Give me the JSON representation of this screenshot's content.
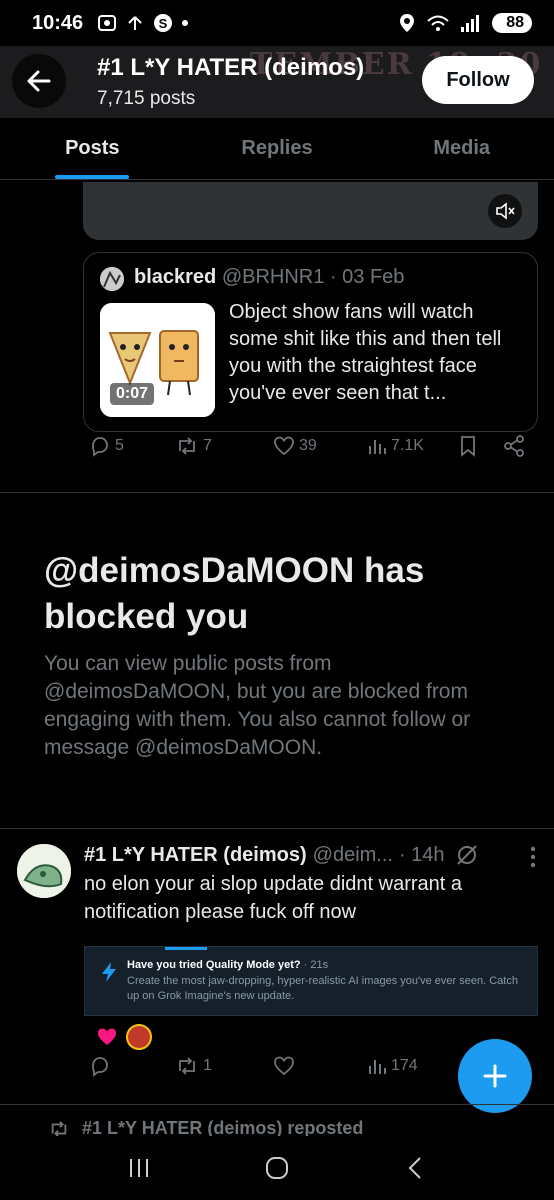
{
  "status_bar": {
    "time": "10:46",
    "battery": "88"
  },
  "header": {
    "title": "#1 L*Y HATER (deimos)",
    "posts_count": "7,715 posts",
    "follow_label": "Follow",
    "banner_text": "TEMBER 18, 20"
  },
  "tabs": [
    {
      "label": "Posts",
      "active": true
    },
    {
      "label": "Replies",
      "active": false
    },
    {
      "label": "Media",
      "active": false
    }
  ],
  "quoted_post": {
    "name": "blackred",
    "handle": "@BRHNR1",
    "date": "· 03 Feb",
    "video_duration": "0:07",
    "text": "Object show fans will watch some shit like this and then tell you with the straightest face you've ever seen that t..."
  },
  "post1_actions": {
    "replies": "5",
    "reposts": "7",
    "likes": "39",
    "views": "7.1K"
  },
  "blocked": {
    "title": "@deimosDaMOON has blocked you",
    "message": "You can view public posts from @deimosDaMOON, but you are blocked from engaging with them. You also cannot follow or message @deimosDaMOON."
  },
  "post2": {
    "name": "#1 L*Y HATER (deimos)",
    "handle": "@deim...",
    "time": "· 14h",
    "text": "no elon your ai slop update didnt warrant a notification please fuck off now",
    "media_title": "Have you tried Quality Mode yet?",
    "media_time": "· 21s",
    "media_body": "Create the most jaw-dropping, hyper-realistic AI images you've ever seen. Catch up on Grok Imagine's new update.",
    "reposts": "1",
    "views": "174"
  },
  "repost_line": "#1 L*Y HATER (deimos) reposted",
  "colors": {
    "accent": "#1d9bf0",
    "background": "#000000",
    "muted": "#71767b"
  }
}
